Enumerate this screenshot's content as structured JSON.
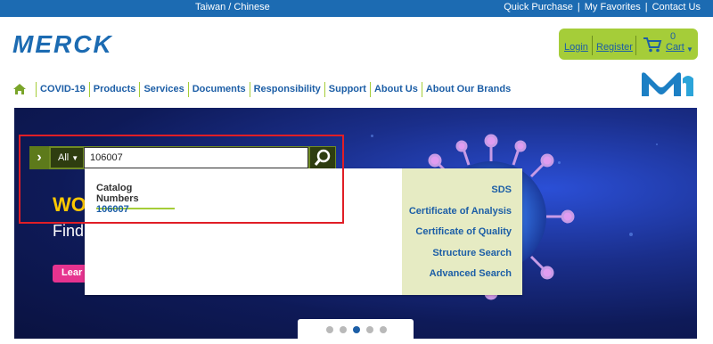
{
  "topbar": {
    "locale": "Taiwan / Chinese",
    "links": [
      "Quick Purchase",
      "My Favorites",
      "Contact Us"
    ]
  },
  "brand": {
    "logo_text": "MERCK"
  },
  "user": {
    "login": "Login",
    "register": "Register",
    "cart_count": "0",
    "cart_label": "Cart"
  },
  "nav": {
    "items": [
      "COVID-19",
      "Products",
      "Services",
      "Documents",
      "Responsibility",
      "Support",
      "About Us",
      "About Our Brands"
    ]
  },
  "hero": {
    "line1": "WO",
    "line2": "Find",
    "button": "Lear"
  },
  "search": {
    "scope": "All",
    "value": "106007"
  },
  "dropdown": {
    "heading": "Catalog Numbers",
    "result": "106007",
    "links": [
      "SDS",
      "Certificate of Analysis",
      "Certificate of Quality",
      "Structure Search",
      "Advanced Search"
    ]
  },
  "carousel": {
    "slides": 5,
    "active": 3
  },
  "colors": {
    "topbar": "#1c6bb2",
    "accent_green": "#a5cd39",
    "link_blue": "#1c5ea6",
    "highlight_red": "#e01e26"
  }
}
